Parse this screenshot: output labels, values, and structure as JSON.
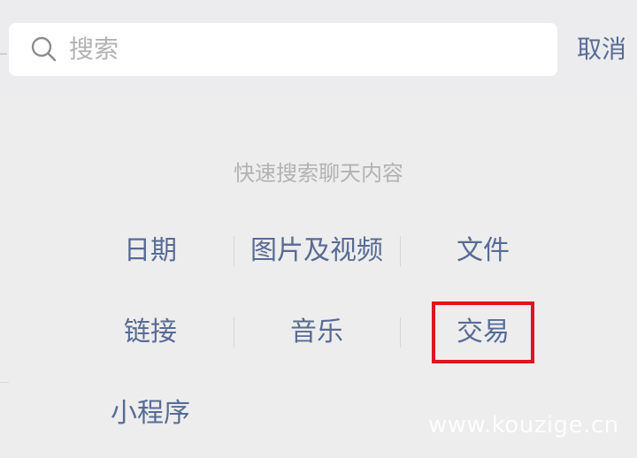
{
  "search": {
    "placeholder": "搜索",
    "cancel_label": "取消"
  },
  "hint": "快速搜索聊天内容",
  "categories": {
    "row1": [
      "日期",
      "图片及视频",
      "文件"
    ],
    "row2": [
      "链接",
      "音乐",
      "交易"
    ],
    "row3": [
      "小程序"
    ]
  },
  "watermark": "www.kouzige.cn",
  "colors": {
    "link": "#576b95",
    "highlight": "#e0151c",
    "background": "#ededed"
  }
}
